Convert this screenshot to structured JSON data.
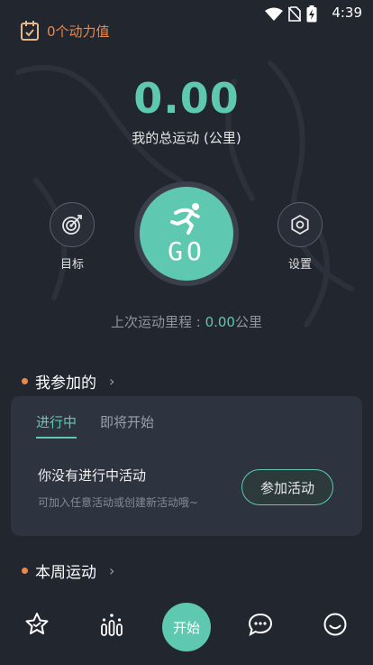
{
  "status_bar": {
    "time": "4:39"
  },
  "energy": {
    "label": "0个动力值"
  },
  "summary": {
    "total_value": "0.00",
    "total_label": "我的总运动 (公里)"
  },
  "actions": {
    "target_label": "目标",
    "go_label": "GO",
    "settings_label": "设置"
  },
  "last_run": {
    "prefix": "上次运动里程 : ",
    "value": "0.00",
    "unit": "公里"
  },
  "joined": {
    "title": "我参加的",
    "tabs": [
      {
        "label": "进行中",
        "active": true
      },
      {
        "label": "即将开始",
        "active": false
      }
    ],
    "empty_title": "你没有进行中活动",
    "empty_sub": "可加入任意活动或创建新活动哦~",
    "join_button": "参加活动"
  },
  "weekly": {
    "title": "本周运动"
  },
  "tabbar": {
    "start_label": "开始",
    "items": [
      "badge-icon",
      "rank-icon",
      "start",
      "chat-icon",
      "profile-icon"
    ]
  },
  "colors": {
    "accent": "#5ec8b0",
    "orange": "#e8894a",
    "background": "#22262f"
  }
}
